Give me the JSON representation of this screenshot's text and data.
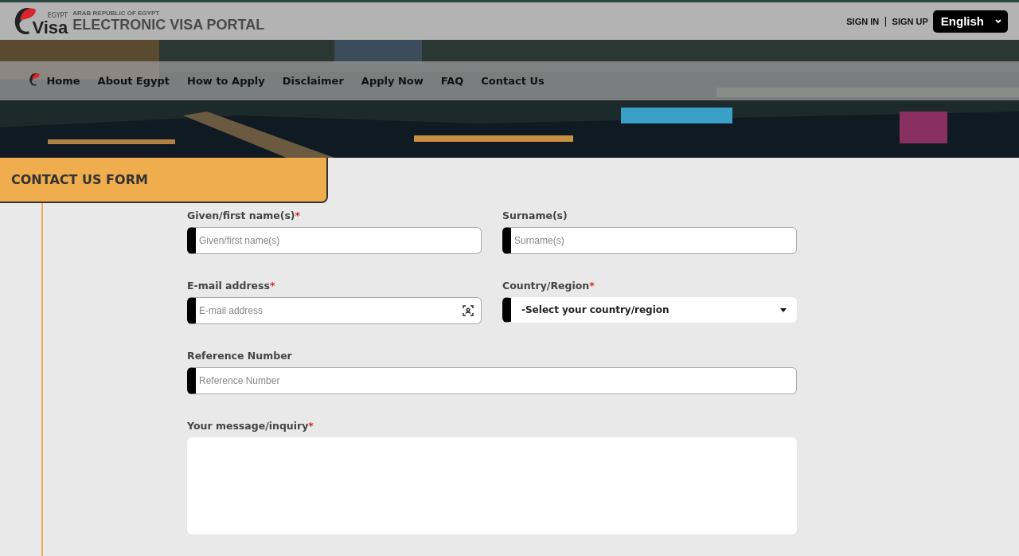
{
  "header": {
    "logo_small": "EGYPT",
    "logo_word": "Visa",
    "subtitle": "ARAB REPUBLIC OF EGYPT",
    "title": "ELECTRONIC VISA PORTAL",
    "sign_in": "SIGN IN",
    "separator": "|",
    "sign_up": "SIGN UP",
    "language": "English"
  },
  "nav": {
    "items": [
      {
        "label": "Home"
      },
      {
        "label": "About Egypt"
      },
      {
        "label": "How to Apply"
      },
      {
        "label": "Disclaimer"
      },
      {
        "label": "Apply Now"
      },
      {
        "label": "FAQ"
      },
      {
        "label": "Contact Us"
      }
    ]
  },
  "form": {
    "title": "CONTACT US FORM",
    "rows": [
      [
        {
          "kind": "text",
          "label": "Given/first name(s)",
          "mark": "*",
          "placeholder": "Given/first name(s)"
        },
        {
          "kind": "text",
          "label": "Surname(s)",
          "placeholder": "Surname(s)"
        }
      ],
      [
        {
          "kind": "email",
          "label": "E-mail address",
          "mark": "*",
          "placeholder": "E-mail address"
        },
        {
          "kind": "select",
          "label": "Country/Region",
          "mark": "*",
          "value": "-Select your country/region"
        }
      ],
      [
        {
          "kind": "text",
          "label": "Reference Number",
          "placeholder": "Reference Number"
        }
      ],
      [
        {
          "kind": "textarea",
          "label": "Your message/inquiry",
          "mark": "*"
        }
      ]
    ]
  }
}
